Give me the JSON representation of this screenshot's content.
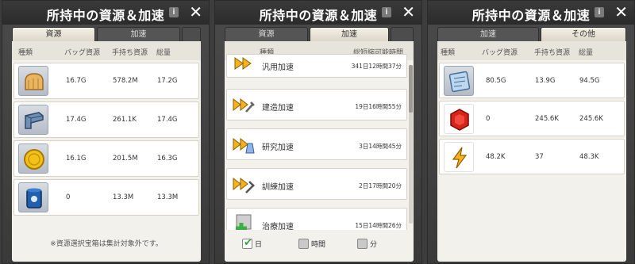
{
  "panels": [
    {
      "title": "所持中の資源＆加速",
      "tabs": [
        "資源",
        "加速"
      ],
      "active_tab": 0,
      "columns": [
        "種類",
        "バッグ資源",
        "手持ち資源",
        "総量"
      ],
      "rows": [
        {
          "icon": "bread-icon",
          "bag": "16.7G",
          "hand": "578.2M",
          "total": "17.2G"
        },
        {
          "icon": "stone-icon",
          "bag": "17.4G",
          "hand": "261.1K",
          "total": "17.4G"
        },
        {
          "icon": "gold-coin-icon",
          "bag": "16.1G",
          "hand": "201.5M",
          "total": "16.3G"
        },
        {
          "icon": "oil-barrel-icon",
          "bag": "0",
          "hand": "13.3M",
          "total": "13.3M"
        }
      ],
      "note": "※資源選択宝箱は集計対象外です。"
    },
    {
      "title": "所持中の資源＆加速",
      "tabs": [
        "資源",
        "加速"
      ],
      "active_tab": 1,
      "columns": [
        "種類",
        "総短縮可能時間"
      ],
      "rows": [
        {
          "icon": "general-speedup-icon",
          "name": "汎用加速",
          "time": "341日12時間37分"
        },
        {
          "icon": "build-speedup-icon",
          "name": "建造加速",
          "time": "19日16時間55分"
        },
        {
          "icon": "research-speedup-icon",
          "name": "研究加速",
          "time": "3日14時間45分"
        },
        {
          "icon": "training-speedup-icon",
          "name": "訓練加速",
          "time": "2日17時間20分"
        },
        {
          "icon": "healing-speedup-icon",
          "name": "治療加速",
          "time": "15日14時間26分"
        }
      ],
      "filters": [
        {
          "label": "日",
          "checked": true
        },
        {
          "label": "時間",
          "checked": false
        },
        {
          "label": "分",
          "checked": false
        }
      ]
    },
    {
      "title": "所持中の資源＆加速",
      "tabs": [
        "加速",
        "その他"
      ],
      "active_tab": 1,
      "columns": [
        "種類",
        "バッグ資源",
        "手持ち資源",
        "総量"
      ],
      "rows": [
        {
          "icon": "blueprint-icon",
          "bag": "80.5G",
          "hand": "13.9G",
          "total": "94.5G"
        },
        {
          "icon": "red-gem-icon",
          "bag": "0",
          "hand": "245.6K",
          "total": "245.6K"
        },
        {
          "icon": "lightning-icon",
          "bag": "48.2K",
          "hand": "37",
          "total": "48.3K"
        }
      ]
    }
  ]
}
